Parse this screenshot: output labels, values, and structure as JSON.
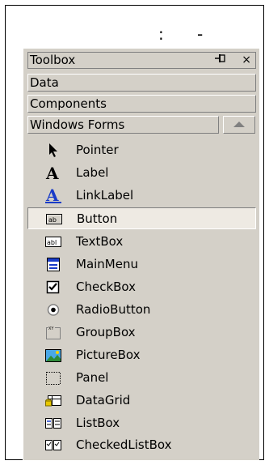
{
  "caption": {
    "colon": ":",
    "dash": "-"
  },
  "toolbox": {
    "title": "Toolbox",
    "pin_glyph": "−Ɣ",
    "close_glyph": "×",
    "tabs": [
      "Data",
      "Components",
      "Windows Forms"
    ],
    "items": [
      {
        "label": "Pointer",
        "icon": "pointer-icon"
      },
      {
        "label": "Label",
        "icon": "label-icon"
      },
      {
        "label": "LinkLabel",
        "icon": "linklabel-icon"
      },
      {
        "label": "Button",
        "icon": "button-icon",
        "selected": true
      },
      {
        "label": "TextBox",
        "icon": "textbox-icon"
      },
      {
        "label": "MainMenu",
        "icon": "mainmenu-icon"
      },
      {
        "label": "CheckBox",
        "icon": "checkbox-icon"
      },
      {
        "label": "RadioButton",
        "icon": "radiobutton-icon"
      },
      {
        "label": "GroupBox",
        "icon": "groupbox-icon"
      },
      {
        "label": "PictureBox",
        "icon": "picturebox-icon"
      },
      {
        "label": "Panel",
        "icon": "panel-icon"
      },
      {
        "label": "DataGrid",
        "icon": "datagrid-icon"
      },
      {
        "label": "ListBox",
        "icon": "listbox-icon"
      },
      {
        "label": "CheckedListBox",
        "icon": "checkedlistbox-icon"
      }
    ]
  }
}
